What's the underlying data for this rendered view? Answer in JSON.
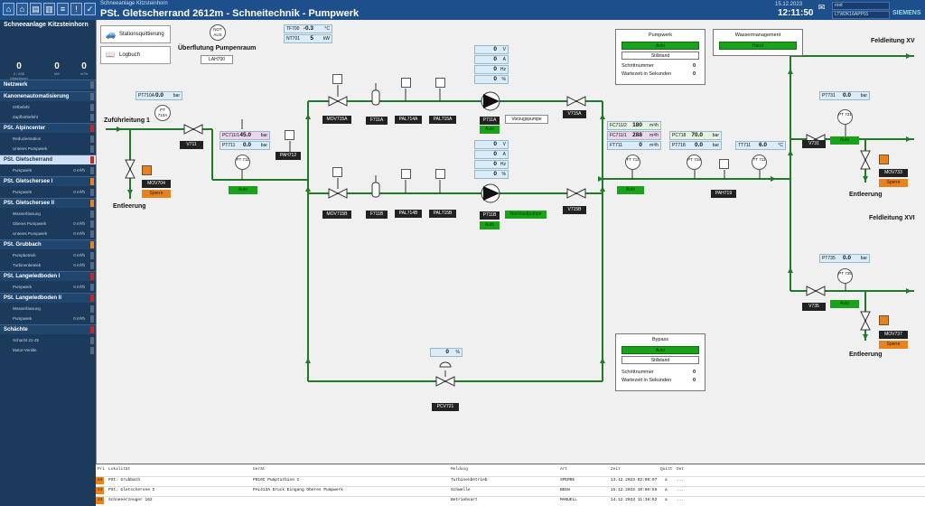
{
  "topbar": {
    "subtitle": "Schneeanlage Kitzsteinhorn",
    "title": "PSt. Gletscherrand 2612m - Schneitechnik - Pumpwerk",
    "date": "15.12.2023",
    "time": "12:11:50",
    "user": "root",
    "station": "LTW2K16APP01",
    "brand": "SIEMENS"
  },
  "sidebar": {
    "title": "Schneeanlage Kitzsteinhorn",
    "kpis": [
      {
        "value": "0",
        "unit": "0 / 836",
        "label": "Maschinen"
      },
      {
        "value": "0",
        "unit": "kW",
        "label": ""
      },
      {
        "value": "0",
        "unit": "m³/h",
        "label": ""
      }
    ],
    "items": [
      {
        "type": "sec",
        "label": "Netzwerk"
      },
      {
        "type": "sec",
        "label": "Kanonenautomatisierung"
      },
      {
        "type": "sub",
        "label": "Ortbefehl"
      },
      {
        "type": "sub",
        "label": "Zapfhörbefehl"
      },
      {
        "type": "sec",
        "label": "PSt. Alpincenter"
      },
      {
        "type": "sub",
        "label": "Reduzierstation"
      },
      {
        "type": "sub",
        "label": "Unteres Pumpwerk"
      },
      {
        "type": "sec",
        "label": "PSt. Gletscherrand",
        "selected": true
      },
      {
        "type": "sub",
        "label": "Pumpwerk",
        "value": "0 m³/h"
      },
      {
        "type": "sec",
        "label": "PSt. Gletschersee I"
      },
      {
        "type": "sub",
        "label": "Pumpwerk",
        "value": "0 m³/h"
      },
      {
        "type": "sec",
        "label": "PSt. Gletschersee II"
      },
      {
        "type": "sub",
        "label": "Wasserfassung"
      },
      {
        "type": "sub",
        "label": "Oberes Pumpwerk",
        "value": "0 m³/h"
      },
      {
        "type": "sub",
        "label": "Unteres Pumpwerk",
        "value": "0 m³/h"
      },
      {
        "type": "sec",
        "label": "PSt. Grubbach"
      },
      {
        "type": "sub",
        "label": "Pumpbetrieb",
        "value": "0 m³/h"
      },
      {
        "type": "sub",
        "label": "Turbinenbetrieb",
        "value": "0 m³/h"
      },
      {
        "type": "sec",
        "label": "PSt. Langwiedboden I"
      },
      {
        "type": "sub",
        "label": "Pumpwerk",
        "value": "0 m³/h"
      },
      {
        "type": "sec",
        "label": "PSt. Langwiedboden II"
      },
      {
        "type": "sub",
        "label": "Wasserfassung"
      },
      {
        "type": "sub",
        "label": "Pumpwerk",
        "value": "0 m³/h"
      },
      {
        "type": "sec",
        "label": "Schächte"
      },
      {
        "type": "sub",
        "label": "Schacht 21-25"
      },
      {
        "type": "sub",
        "label": "Motor-Ventile"
      }
    ]
  },
  "buttons": {
    "ack": "Stationsquittierung",
    "log": "Logbuch"
  },
  "overflow": {
    "title": "Überflutung Pumpenraum",
    "notaus": "NOT AUS",
    "tag": "LAH700"
  },
  "tf700": {
    "label": "TF700",
    "value": "-0.3",
    "unit": "°C"
  },
  "nt701": {
    "label": "NT701",
    "value": "5",
    "unit": "kW"
  },
  "pumpwerk": {
    "title": "Pumpwerk",
    "state1": "Auto",
    "state2": "Stillstand",
    "row1": "Schrittnummer",
    "row1v": "0",
    "row2": "Wartezeit in Sekunden",
    "row2v": "0"
  },
  "wasser": {
    "title": "Wassermanagement",
    "state": "Hand"
  },
  "bypass": {
    "title": "Bypass",
    "state1": "Auto",
    "state2": "Stillstand",
    "row1": "Schrittnummer",
    "row1v": "0",
    "row2": "Wartezeit in Sekunden",
    "row2v": "0"
  },
  "labels": {
    "zuf": "Zuführleitung 1",
    "entl1": "Entleerung",
    "entl2": "Entleerung",
    "entl3": "Entleerung",
    "feldxv": "Feldleitung XV",
    "feldxvi": "Feldleitung XVI",
    "vorzug": "Vorzugspumpe"
  },
  "pumpA": {
    "vals": [
      {
        "v": "0",
        "u": "V"
      },
      {
        "v": "0",
        "u": "A"
      },
      {
        "v": "0",
        "u": "Hz"
      },
      {
        "v": "0",
        "u": "%"
      }
    ]
  },
  "pumpB": {
    "vals": [
      {
        "v": "0",
        "u": "V"
      },
      {
        "v": "0",
        "u": "A"
      },
      {
        "v": "0",
        "u": "Hz"
      },
      {
        "v": "0",
        "u": "%"
      }
    ],
    "status": "Nachlaufpumpe"
  },
  "tags": {
    "mov715a": "MOV715A",
    "f711a": "F711A",
    "pal714a": "PAL714A",
    "pal715a": "PAL715A",
    "p711a": "P711A",
    "v715a": "V715A",
    "mov715b": "MOV715B",
    "f711b": "F711B",
    "pal714b": "PAL714B",
    "pal715b": "PAL715B",
    "p711b": "P711B",
    "v715b": "V715B",
    "v711": "V711",
    "mov704": "MOV704",
    "sperre1": "Sperre",
    "pah712": "PAH712",
    "pcv721": "PCV721",
    "pah719": "PAH719",
    "v731": "V731",
    "mov733": "MOV733",
    "sperre2": "Sperre",
    "v735": "V735",
    "mov737": "MOV737",
    "sperre3": "Sperre",
    "auto": "Auto",
    "pt711": "PT 711",
    "pt710a": "PT 710A",
    "ft711": "FT 711",
    "pt718": "PT 718",
    "tt711": "TT 711",
    "pt731": "PT 731",
    "pt735": "PT 735"
  },
  "pv": {
    "pt710a": {
      "l": "PT710A",
      "v": "0.0",
      "u": "bar"
    },
    "pc711": {
      "l": "PC711/1",
      "v": "45.0",
      "u": "bar"
    },
    "pt711": {
      "l": "PT711",
      "v": "0.0",
      "u": "bar"
    },
    "fc711_2": {
      "l": "FC711/2",
      "v": "180",
      "u": "m³/h"
    },
    "fc711_1": {
      "l": "FC711/1",
      "v": "288",
      "u": "m³/h"
    },
    "ft711": {
      "l": "FT711",
      "v": "0",
      "u": "m³/h"
    },
    "pc718": {
      "l": "PC718",
      "v": "70.0",
      "u": "bar"
    },
    "pt718": {
      "l": "PT718",
      "v": "0.0",
      "u": "bar"
    },
    "tt711": {
      "l": "TT711",
      "v": "6.0",
      "u": "°C"
    },
    "pt731": {
      "l": "PT731",
      "v": "0.0",
      "u": "bar"
    },
    "pt735": {
      "l": "PT735",
      "v": "0.0",
      "u": "bar"
    },
    "pcv": {
      "v": "0",
      "u": "%"
    }
  },
  "alarms": {
    "headers": [
      "Pri",
      "Lokalität",
      "Gerät",
      "Meldung",
      "Art",
      "Zeit",
      "Quitt",
      "Det"
    ],
    "rows": [
      {
        "pri": "44",
        "loc": "PSt. Grubbach",
        "dev": "P010C Pumpturbine C",
        "msg": "Turbinenbetrieb",
        "art": "SPERRE",
        "time": "13.12.2023 02:00:07",
        "q": "a",
        "det": "..."
      },
      {
        "pri": "44",
        "loc": "PSt. Gletschersee I",
        "dev": "PAL413A Druck Eingang Oberes Pumpwerk",
        "msg": "Schwelle",
        "art": "BEEN",
        "time": "15.12.2023 10:00:55",
        "q": "a",
        "det": "..."
      },
      {
        "pri": "44",
        "loc": "Schneeerzeuger 162",
        "dev": "",
        "msg": "Betriebsart",
        "art": "MANUELL",
        "time": "14.12.2023 11:38:52",
        "q": "a",
        "det": "..."
      }
    ]
  },
  "colors": {
    "pipe": "#1f7a2a",
    "accent": "#1d4f8c",
    "green": "#1aa31a",
    "orange": "#e8821c"
  }
}
